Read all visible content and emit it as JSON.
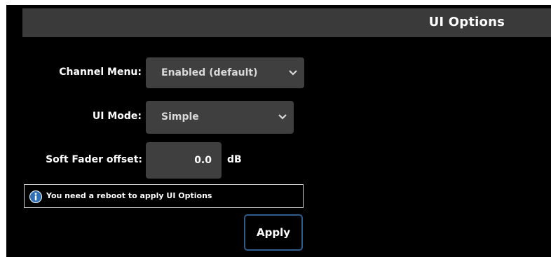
{
  "header": {
    "title": "UI Options"
  },
  "form": {
    "channel_menu": {
      "label": "Channel Menu:",
      "value": "Enabled (default)"
    },
    "ui_mode": {
      "label": "UI Mode:",
      "value": "Simple"
    },
    "soft_fader_offset": {
      "label": "Soft Fader offset:",
      "value": "0.0",
      "unit": "dB"
    }
  },
  "notice": {
    "icon": "info-icon",
    "text": "You need a reboot to apply UI Options"
  },
  "actions": {
    "apply_label": "Apply"
  },
  "colors": {
    "background": "#000000",
    "title_bar": "#3a3a3a",
    "control_bg": "#3f3f3f",
    "apply_border": "#2f5b8d",
    "info_icon": "#2f6fb5"
  }
}
